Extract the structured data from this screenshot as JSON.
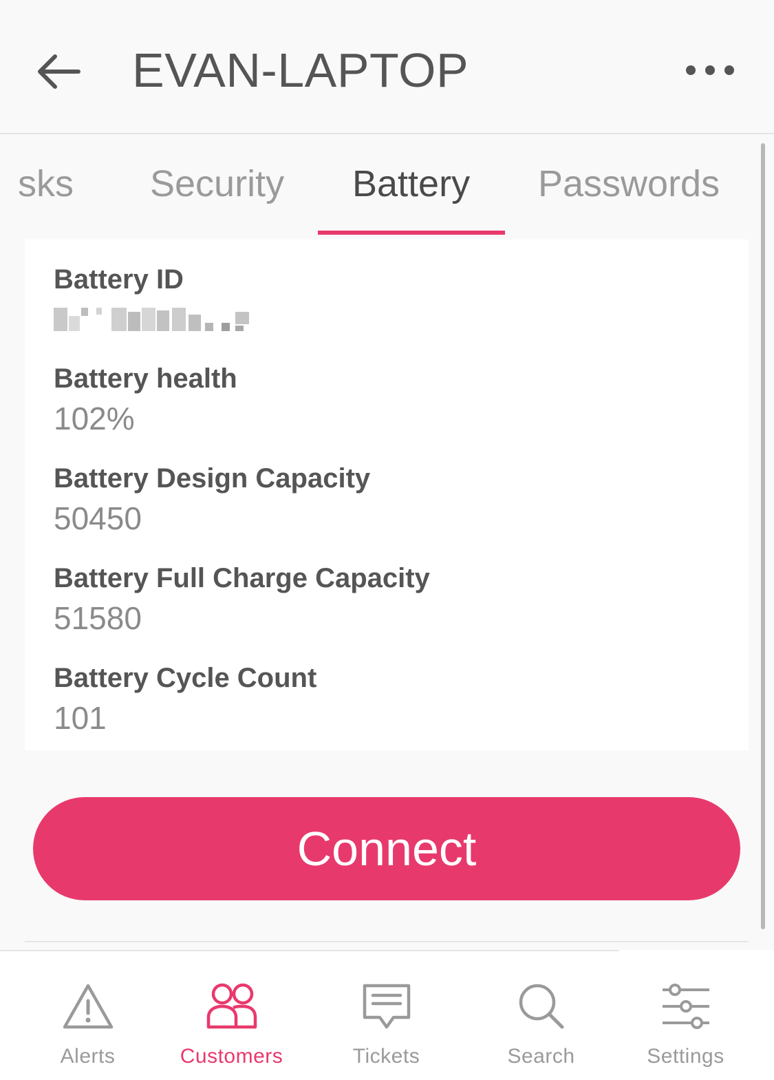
{
  "header": {
    "title": "EVAN-LAPTOP",
    "back_icon": "arrow-left-icon",
    "more_icon": "more-horizontal-icon"
  },
  "tabs": [
    {
      "label": "sks",
      "active": false
    },
    {
      "label": "Security",
      "active": false
    },
    {
      "label": "Battery",
      "active": true
    },
    {
      "label": "Passwords",
      "active": false
    }
  ],
  "battery": {
    "fields": [
      {
        "label": "Battery ID",
        "value": null,
        "redacted": true
      },
      {
        "label": "Battery health",
        "value": "102%"
      },
      {
        "label": "Battery Design Capacity",
        "value": "50450"
      },
      {
        "label": "Battery Full Charge Capacity",
        "value": "51580"
      },
      {
        "label": "Battery Cycle Count",
        "value": "101"
      }
    ]
  },
  "connect_button": {
    "label": "Connect"
  },
  "bottom_nav": {
    "items": [
      {
        "label": "Alerts",
        "icon": "alert-triangle-icon",
        "active": false
      },
      {
        "label": "Customers",
        "icon": "users-icon",
        "active": true
      },
      {
        "label": "Tickets",
        "icon": "message-square-icon",
        "active": false
      },
      {
        "label": "Search",
        "icon": "search-icon",
        "active": false
      },
      {
        "label": "Settings",
        "icon": "sliders-icon",
        "active": false
      }
    ]
  },
  "colors": {
    "accent": "#e8396d",
    "text_primary": "#555555",
    "text_muted": "#9a9a9a",
    "background": "#f9f9f9"
  }
}
